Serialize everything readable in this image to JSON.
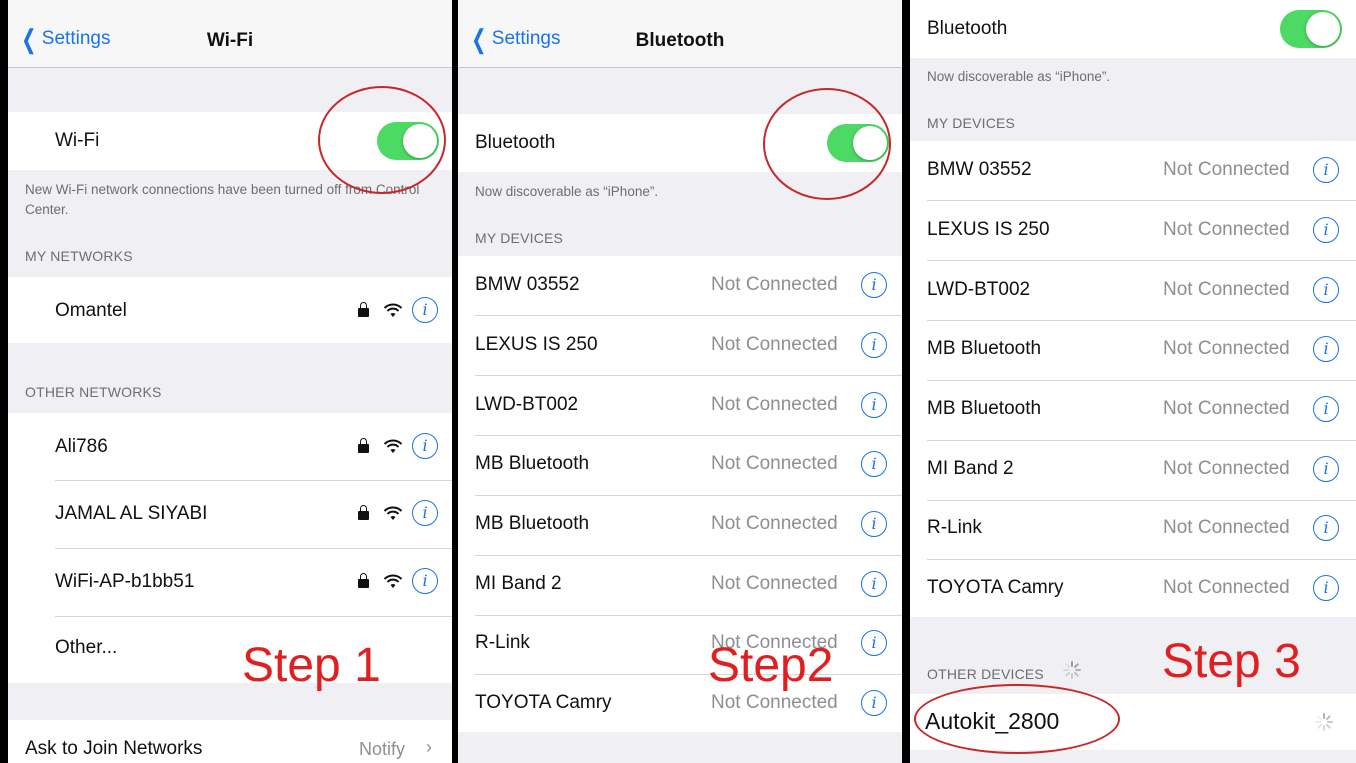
{
  "wifi_panel": {
    "back_label": "Settings",
    "title": "Wi-Fi",
    "wifi_label": "Wi-Fi",
    "toggle_on": true,
    "note": "New Wi-Fi network connections have been turned off from Control Center.",
    "my_networks_title": "MY NETWORKS",
    "my_networks": [
      {
        "name": "Omantel"
      }
    ],
    "other_networks_title": "OTHER NETWORKS",
    "other_networks": [
      {
        "name": "Ali786"
      },
      {
        "name": "JAMAL AL SIYABI"
      },
      {
        "name": "WiFi-AP-b1bb51"
      }
    ],
    "other_label": "Other...",
    "ask_label": "Ask to Join Networks",
    "ask_value": "Notify",
    "step_label": "Step 1"
  },
  "bt_panel": {
    "back_label": "Settings",
    "title": "Bluetooth",
    "bt_label": "Bluetooth",
    "toggle_on": true,
    "discoverable": "Now discoverable as “iPhone”.",
    "my_devices_title": "MY DEVICES",
    "devices": [
      {
        "name": "BMW 03552",
        "status": "Not Connected"
      },
      {
        "name": "LEXUS IS 250",
        "status": "Not Connected"
      },
      {
        "name": "LWD-BT002",
        "status": "Not Connected"
      },
      {
        "name": "MB Bluetooth",
        "status": "Not Connected"
      },
      {
        "name": "MB Bluetooth",
        "status": "Not Connected"
      },
      {
        "name": "MI Band 2",
        "status": "Not Connected"
      },
      {
        "name": "R-Link",
        "status": "Not Connected"
      },
      {
        "name": "TOYOTA Camry",
        "status": "Not Connected"
      }
    ],
    "step_label": "Step2"
  },
  "bt_panel2": {
    "bt_label": "Bluetooth",
    "toggle_on": true,
    "discoverable": "Now discoverable as “iPhone”.",
    "my_devices_title": "MY DEVICES",
    "devices": [
      {
        "name": "BMW 03552",
        "status": "Not Connected"
      },
      {
        "name": "LEXUS IS 250",
        "status": "Not Connected"
      },
      {
        "name": "LWD-BT002",
        "status": "Not Connected"
      },
      {
        "name": "MB Bluetooth",
        "status": "Not Connected"
      },
      {
        "name": "MB Bluetooth",
        "status": "Not Connected"
      },
      {
        "name": "MI Band 2",
        "status": "Not Connected"
      },
      {
        "name": "R-Link",
        "status": "Not Connected"
      },
      {
        "name": "TOYOTA Camry",
        "status": "Not Connected"
      }
    ],
    "other_devices_title": "OTHER DEVICES",
    "other_device": "Autokit_2800",
    "step_label": "Step 3"
  },
  "colors": {
    "accent": "#1a73e8",
    "toggle_on": "#4cd964",
    "annotation": "#e02020"
  }
}
